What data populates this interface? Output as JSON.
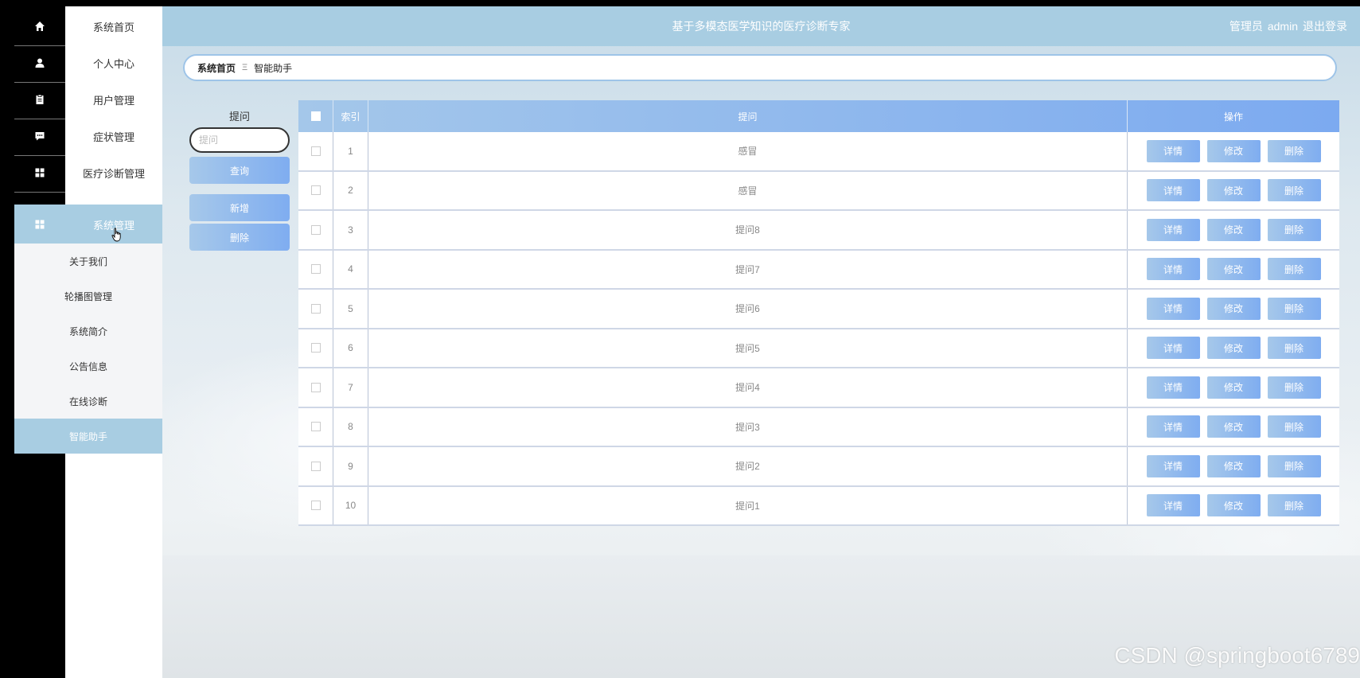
{
  "header": {
    "title": "基于多模态医学知识的医疗诊断专家",
    "role": "管理员",
    "username": "admin",
    "logout": "退出登录"
  },
  "sidebar": {
    "items": [
      {
        "label": "系统首页",
        "icon": "home-icon"
      },
      {
        "label": "个人中心",
        "icon": "user-icon"
      },
      {
        "label": "用户管理",
        "icon": "clipboard-icon"
      },
      {
        "label": "症状管理",
        "icon": "chat-icon"
      },
      {
        "label": "医疗诊断管理",
        "icon": "grid-icon"
      },
      {
        "label": "系统管理",
        "icon": "grid-icon",
        "active": true
      }
    ],
    "submenu": [
      {
        "label": "关于我们"
      },
      {
        "label": "轮播图管理"
      },
      {
        "label": "系统简介"
      },
      {
        "label": "公告信息"
      },
      {
        "label": "在线诊断"
      },
      {
        "label": "智能助手",
        "active": true
      }
    ]
  },
  "breadcrumb": {
    "home": "系统首页",
    "separator": "Ξ",
    "current": "智能助手"
  },
  "search": {
    "label": "提问",
    "placeholder": "提问",
    "query_button": "查询",
    "add_button": "新增",
    "delete_button": "删除"
  },
  "table": {
    "headers": {
      "index": "索引",
      "question": "提问",
      "actions": "操作"
    },
    "rows": [
      {
        "index": "1",
        "question": "感冒"
      },
      {
        "index": "2",
        "question": "感冒"
      },
      {
        "index": "3",
        "question": "提问8"
      },
      {
        "index": "4",
        "question": "提问7"
      },
      {
        "index": "5",
        "question": "提问6"
      },
      {
        "index": "6",
        "question": "提问5"
      },
      {
        "index": "7",
        "question": "提问4"
      },
      {
        "index": "8",
        "question": "提问3"
      },
      {
        "index": "9",
        "question": "提问2"
      },
      {
        "index": "10",
        "question": "提问1"
      }
    ],
    "row_actions": {
      "detail": "详情",
      "edit": "修改",
      "delete": "删除"
    }
  },
  "watermark": "CSDN @springboot6789",
  "colors": {
    "accent": "#a8cde2",
    "button_start": "#a6c8ea",
    "button_end": "#7fadf0"
  }
}
